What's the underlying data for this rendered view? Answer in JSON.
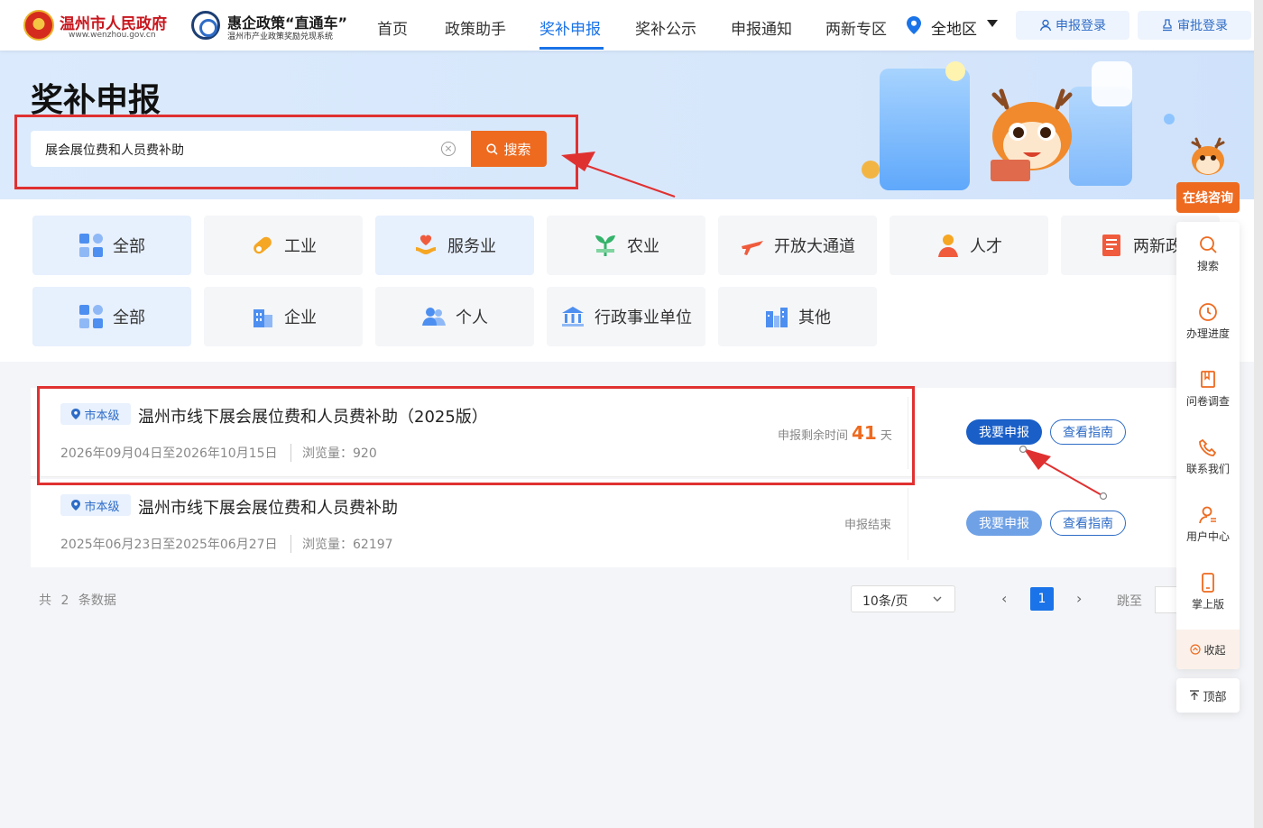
{
  "header": {
    "gov_name": "温州市人民政府",
    "gov_url": "www.wenzhou.gov.cn",
    "system_title": "惠企政策“直通车”",
    "system_subtitle": "温州市产业政策奖励兑现系统",
    "nav": [
      "首页",
      "政策助手",
      "奖补申报",
      "奖补公示",
      "申报通知",
      "两新专区"
    ],
    "active_nav": "奖补申报",
    "region": "全地区",
    "apply_login": "申报登录",
    "approve_login": "审批登录"
  },
  "banner": {
    "title": "奖补申报",
    "search_value": "展会展位费和人员费补助",
    "search_button": "搜索"
  },
  "industry_categories": [
    "全部",
    "工业",
    "服务业",
    "农业",
    "开放大通道",
    "人才",
    "两新政"
  ],
  "subject_categories": [
    "全部",
    "企业",
    "个人",
    "行政事业单位",
    "其他"
  ],
  "items": [
    {
      "level": "市本级",
      "title": "温州市线下展会展位费和人员费补助（2025版）",
      "dates": "2026年09月04日至2026年10月15日",
      "views": "浏览量：920",
      "remain_label": "申报剩余时间",
      "remain_days": "41",
      "remain_unit": "天",
      "status": "",
      "apply_button": "我要申报",
      "guide_button": "查看指南"
    },
    {
      "level": "市本级",
      "title": "温州市线下展会展位费和人员费补助",
      "dates": "2025年06月23日至2025年06月27日",
      "views": "浏览量：62197",
      "remain_label": "",
      "remain_days": "",
      "remain_unit": "",
      "status": "申报结束",
      "apply_button": "我要申报",
      "guide_button": "查看指南"
    }
  ],
  "pagination": {
    "total_prefix": "共",
    "total_count": "2",
    "total_suffix": "条数据",
    "page_size": "10条/页",
    "current_page": "1",
    "jump_label": "跳至"
  },
  "float_panel": {
    "online": "在线咨询",
    "items": [
      "搜索",
      "办理进度",
      "问卷调查",
      "联系我们",
      "用户中心",
      "掌上版"
    ],
    "collapse": "收起",
    "top": "顶部"
  },
  "colors": {
    "primary": "#1a73e8",
    "accent_orange": "#ee6a1f",
    "annotation_red": "#e03131"
  }
}
